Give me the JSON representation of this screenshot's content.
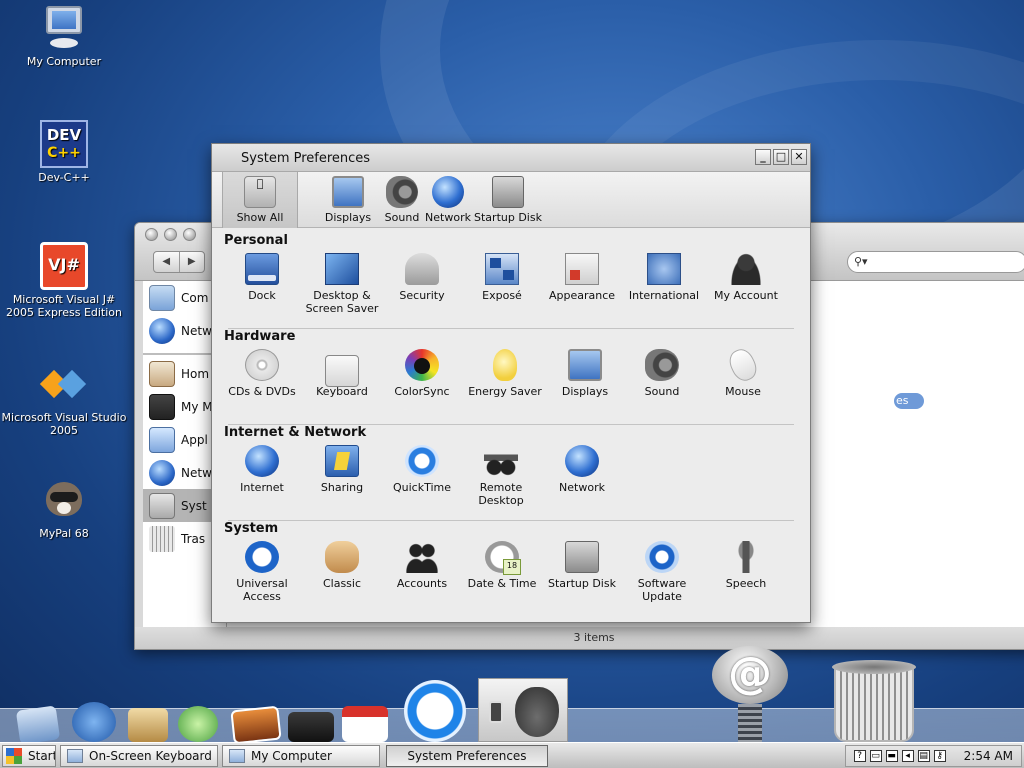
{
  "desktop": {
    "icons": [
      {
        "label": "My Computer",
        "icon": "computer-icon"
      },
      {
        "label": "Dev-C++",
        "icon": "devcpp-icon",
        "art": "DEV"
      },
      {
        "label": "Microsoft Visual J# 2005 Express Edition",
        "icon": "visual-jsharp-icon",
        "art": "VJ#"
      },
      {
        "label": "Microsoft Visual Studio 2005",
        "icon": "visual-studio-icon"
      },
      {
        "label": "MyPal 68",
        "icon": "raccoon-icon"
      }
    ]
  },
  "finder_window": {
    "back_label": "◀",
    "forward_label": "▶",
    "search_glyph": "⚲▾",
    "sidebar": [
      {
        "label": "Com",
        "icon": "computer-icon"
      },
      {
        "label": "Netw",
        "icon": "network-globe-icon"
      },
      {
        "label": "Hom",
        "icon": "home-icon"
      },
      {
        "label": "My M",
        "icon": "movies-icon"
      },
      {
        "label": "Appl",
        "icon": "applications-icon"
      },
      {
        "label": "Netw",
        "icon": "network-globe-icon"
      },
      {
        "label": "Syst",
        "icon": "system-prefs-icon",
        "selected": true
      },
      {
        "label": "Tras",
        "icon": "trash-icon"
      }
    ],
    "pill_text": "es",
    "status": "3 items"
  },
  "sysprefs": {
    "title": "System Preferences",
    "buttons": {
      "minimize": "_",
      "maximize": "□",
      "close": "✕"
    },
    "toolbar": [
      {
        "label": "Show All",
        "icon": "apple-icon"
      },
      {
        "label": "Displays",
        "icon": "display-icon"
      },
      {
        "label": "Sound",
        "icon": "speaker-icon"
      },
      {
        "label": "Network",
        "icon": "network-globe-icon"
      },
      {
        "label": "Startup Disk",
        "icon": "hard-disk-icon"
      }
    ],
    "sections": [
      {
        "title": "Personal",
        "panes": [
          {
            "label": "Dock",
            "icon": "dock-icon"
          },
          {
            "label": "Desktop &\nScreen Saver",
            "icon": "desktop-icon"
          },
          {
            "label": "Security",
            "icon": "security-house-icon"
          },
          {
            "label": "Exposé",
            "icon": "expose-icon"
          },
          {
            "label": "Appearance",
            "icon": "appearance-icon"
          },
          {
            "label": "International",
            "icon": "un-flag-icon"
          },
          {
            "label": "My Account",
            "icon": "account-silhouette-icon"
          }
        ]
      },
      {
        "title": "Hardware",
        "panes": [
          {
            "label": "CDs & DVDs",
            "icon": "cd-icon"
          },
          {
            "label": "Keyboard",
            "icon": "keyboard-icon"
          },
          {
            "label": "ColorSync",
            "icon": "colorsync-icon"
          },
          {
            "label": "Energy Saver",
            "icon": "lightbulb-icon"
          },
          {
            "label": "Displays",
            "icon": "display-icon"
          },
          {
            "label": "Sound",
            "icon": "speaker-icon"
          },
          {
            "label": "Mouse",
            "icon": "mouse-icon"
          }
        ]
      },
      {
        "title": "Internet & Network",
        "panes": [
          {
            "label": "Internet",
            "icon": "globe-icon"
          },
          {
            "label": "Sharing",
            "icon": "sharing-folder-icon"
          },
          {
            "label": "QuickTime",
            "icon": "quicktime-icon"
          },
          {
            "label": "Remote\nDesktop",
            "icon": "binoculars-icon"
          },
          {
            "label": "Network",
            "icon": "network-globe-icon"
          }
        ]
      },
      {
        "title": "System",
        "panes": [
          {
            "label": "Universal\nAccess",
            "icon": "universal-access-icon"
          },
          {
            "label": "Classic",
            "icon": "classic-icon"
          },
          {
            "label": "Accounts",
            "icon": "accounts-icon"
          },
          {
            "label": "Date & Time",
            "icon": "clock-calendar-icon"
          },
          {
            "label": "Startup Disk",
            "icon": "hard-disk-icon"
          },
          {
            "label": "Software\nUpdate",
            "icon": "software-update-icon"
          },
          {
            "label": "Speech",
            "icon": "microphone-icon"
          }
        ]
      }
    ]
  },
  "dock": {
    "mail_glyph": "@"
  },
  "taskbar": {
    "start_label": "Start",
    "tasks": [
      {
        "label": "On-Screen Keyboard",
        "icon": "keyboard-window-icon"
      },
      {
        "label": "My Computer",
        "icon": "computer-window-icon"
      },
      {
        "label": "System Preferences",
        "active": true
      }
    ],
    "tray_glyphs": [
      "?",
      "▭",
      "▬",
      "◂",
      "▤",
      "⚷"
    ],
    "clock": "2:54 AM"
  }
}
